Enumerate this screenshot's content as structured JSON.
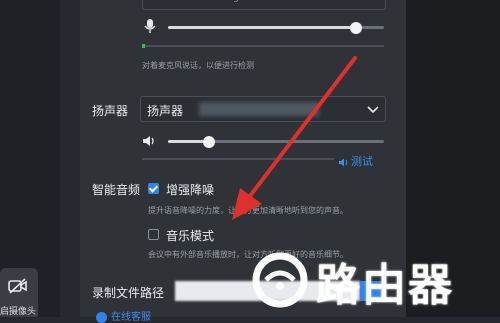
{
  "mic": {
    "top_field_text": "g",
    "volume": 0.87,
    "hint": "对着麦克风说话，以便进行检测"
  },
  "speaker": {
    "label": "扬声器",
    "selected": "扬声器",
    "volume": 0.19,
    "test_label": "测试"
  },
  "smart_audio": {
    "label": "智能音频",
    "noise_option": "增强降噪",
    "noise_checked": true,
    "noise_hint": "提升语音降噪的力度，让对方更加清晰地听到您的声音。",
    "music_option": "音乐模式",
    "music_checked": false,
    "music_hint": "会议中有外部音乐播放时，让对方听到更好的音乐细节。"
  },
  "record": {
    "label": "录制文件路径"
  },
  "online_service": "在线客服",
  "left_panel": {
    "camera_label": "启摄像头"
  },
  "watermark": "路由器",
  "colors": {
    "accent": "#2f83f5",
    "arrow": "#e0302b",
    "panel": "#2f3338"
  }
}
